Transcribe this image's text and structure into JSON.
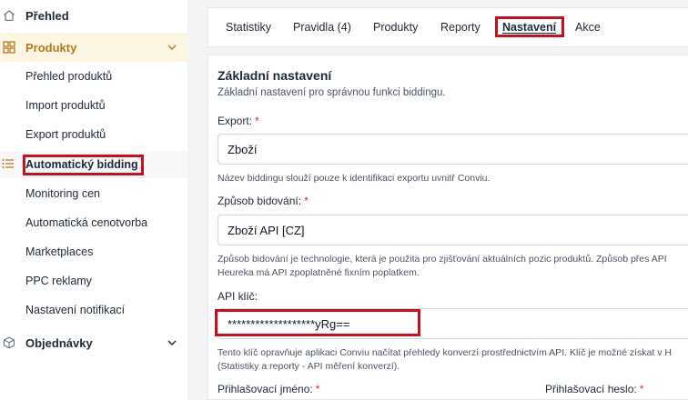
{
  "sidebar": {
    "overview_label": "Přehled",
    "products_label": "Produkty",
    "product_items": [
      {
        "label": "Přehled produktů"
      },
      {
        "label": "Import produktů"
      },
      {
        "label": "Export produktů"
      },
      {
        "label": "Automatický bidding"
      },
      {
        "label": "Monitoring cen"
      },
      {
        "label": "Automatická cenotvorba"
      },
      {
        "label": "Marketplaces"
      },
      {
        "label": "PPC reklamy"
      },
      {
        "label": "Nastavení notifikací"
      }
    ],
    "orders_label": "Objednávky"
  },
  "tabs": [
    {
      "label": "Statistiky"
    },
    {
      "label": "Pravidla (4)"
    },
    {
      "label": "Produkty"
    },
    {
      "label": "Reporty"
    },
    {
      "label": "Nastavení"
    },
    {
      "label": "Akce"
    }
  ],
  "settings": {
    "title": "Základní nastavení",
    "subtitle": "Základní nastavení pro správnou funkci biddingu.",
    "export_label": "Export:",
    "export_value": "Zboží",
    "export_help": "Název biddingu slouží pouze k identifikaci exportu uvnitř Conviu.",
    "method_label": "Způsob bidování:",
    "method_value": "Zboží API [CZ]",
    "method_help_1": "Způsob bidování je technologie, která je použita pro zjišťování aktuálních pozic produktů. Způsob přes API",
    "method_help_2": "Heureka má API zpoplatněné fixním poplatkem.",
    "api_key_label": "API klíč:",
    "api_key_value": "*******************yRg==",
    "api_key_help_1": "Tento klíč opravňuje aplikaci Conviu načítat přehledy konverzí prostřednictvím API. Klíč je možné získat v H",
    "api_key_help_2": "(Statistiky a reporty - API měření konverzí).",
    "login_label": "Přihlašovací jméno:",
    "password_label": "Přihlašovací heslo:",
    "required_mark": "*"
  },
  "colors": {
    "accent": "#b7791f",
    "highlight": "#c1121f",
    "required": "#dc2626"
  }
}
